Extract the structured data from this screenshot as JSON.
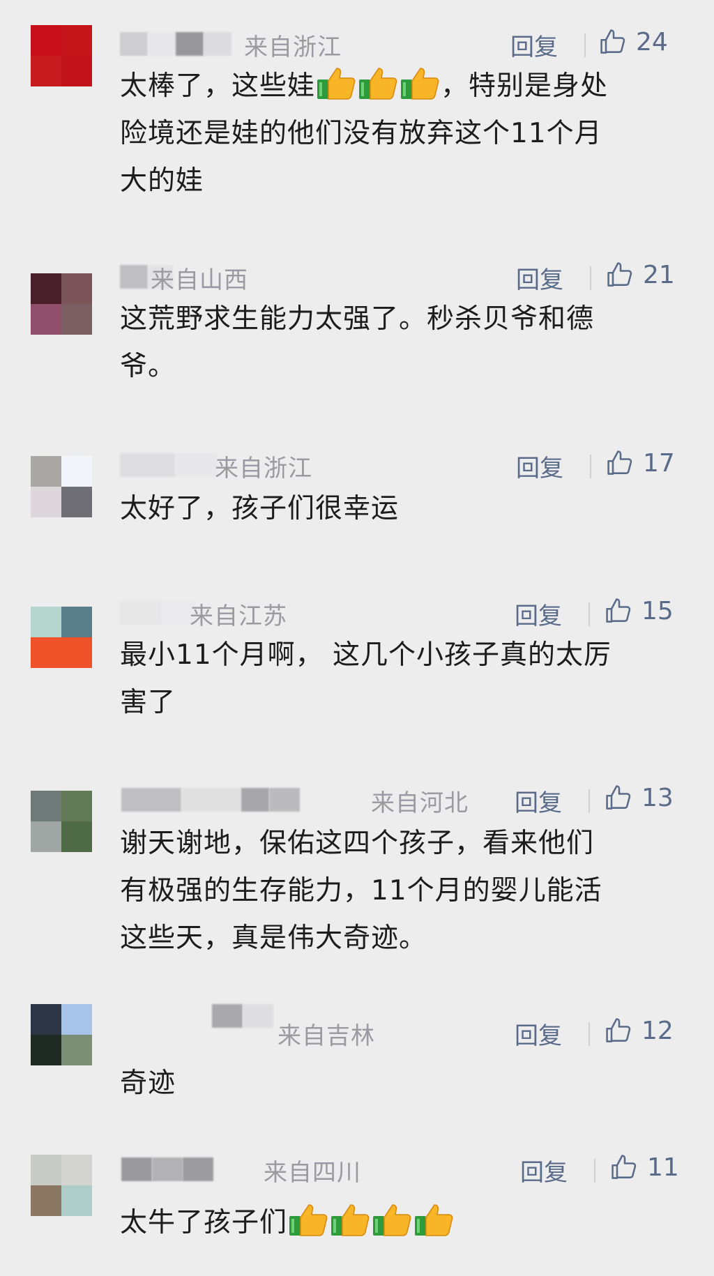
{
  "ui": {
    "reply_label": "回复",
    "icons": {
      "like": "thumbs-up-outline-icon",
      "emoji": "thumbs-up-emoji-icon"
    },
    "colors": {
      "background": "#ededed",
      "reply": "#5a6b8a",
      "location": "#9a9aa0",
      "text": "#1c1c1c"
    }
  },
  "comments": [
    {
      "location": "来自浙江",
      "likes": "24",
      "text_lines": [
        "太棒了，这些娃",
        "，特别是身处",
        "险境还是娃的他们没有放弃这个11个月",
        "大的娃"
      ],
      "avatar_colors": [
        "#c8101a",
        "#c5151b",
        "#c61b1f",
        "#c3131a"
      ]
    },
    {
      "location": "来自山西",
      "likes": "21",
      "text_lines": [
        "这荒野求生能力太强了。秒杀贝爷和德",
        "爷。"
      ],
      "avatar_colors": [
        "#4a1f2c",
        "#7a5458",
        "#8f4f6a",
        "#7a5e62"
      ]
    },
    {
      "location": "来自浙江",
      "likes": "17",
      "text_lines": [
        "太好了，孩子们很幸运"
      ],
      "avatar_colors": [
        "#a9a7a3",
        "#f2f4fb",
        "#ded6dd",
        "#6e6e74"
      ]
    },
    {
      "location": "来自江苏",
      "likes": "15",
      "text_lines": [
        "最小11个月啊， 这几个小孩子真的太厉",
        "害了"
      ],
      "avatar_colors": [
        "#b4d6ce",
        "#5a7d8a",
        "#f0532a",
        "#f0532a"
      ]
    },
    {
      "location": "来自河北",
      "likes": "13",
      "text_lines": [
        "谢天谢地，保佑这四个孩子，看来他们",
        "有极强的生存能力，11个月的婴儿能活",
        "这些天，真是伟大奇迹。"
      ],
      "avatar_colors": [
        "#6f7a78",
        "#627a57",
        "#9fa6a3",
        "#4f6a46"
      ]
    },
    {
      "location": "来自吉林",
      "likes": "12",
      "text_lines": [
        "奇迹"
      ],
      "avatar_colors": [
        "#2d3644",
        "#a8c3e8",
        "#1f2a22",
        "#7a8f76"
      ]
    },
    {
      "location": "来自四川",
      "likes": "11",
      "text_lines": [
        "太牛了孩子们"
      ],
      "avatar_colors": [
        "#c9cbc7",
        "#d3d4d2",
        "#8b7864",
        "#aecdc9"
      ]
    }
  ]
}
